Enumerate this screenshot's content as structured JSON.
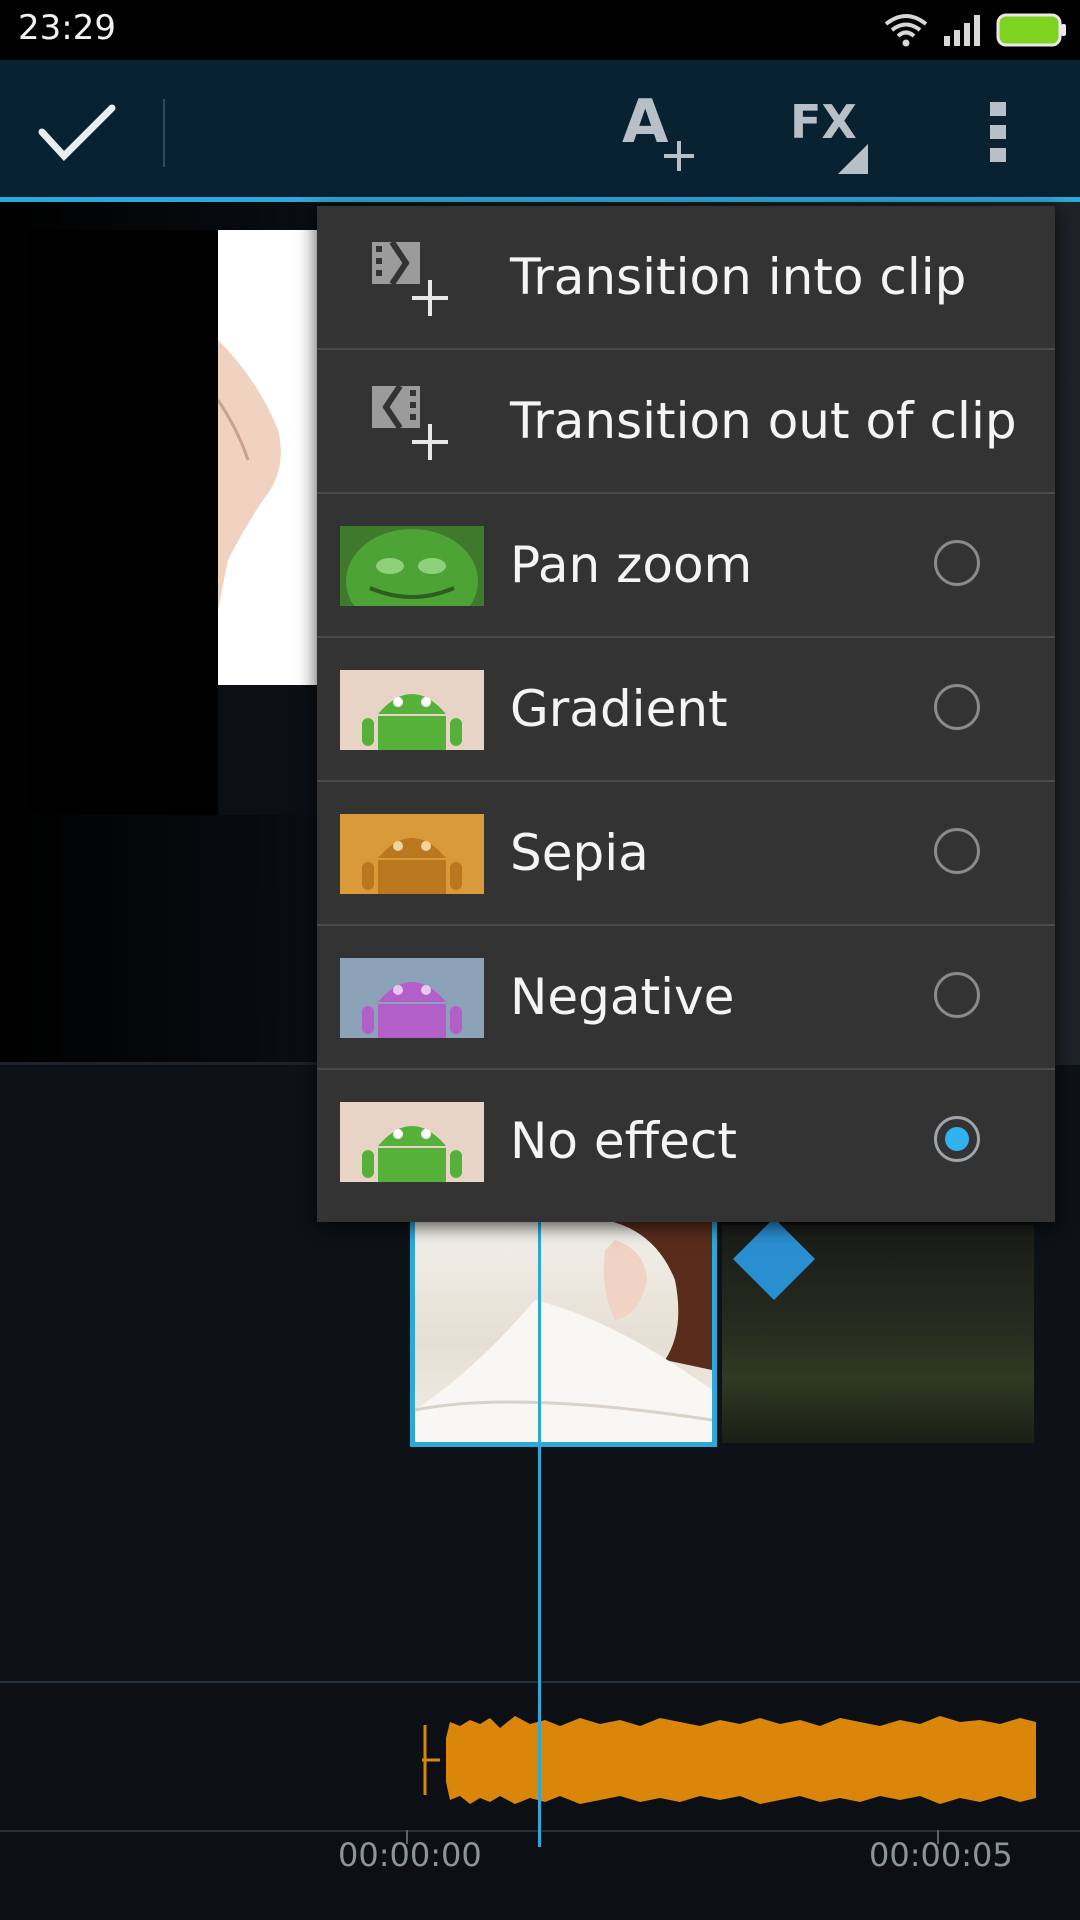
{
  "status_bar": {
    "time": "23:29"
  },
  "action_bar": {
    "done_icon": "checkmark-icon",
    "add_text_icon": "add-text-icon",
    "fx_label": "FX",
    "overflow_icon": "overflow-menu-icon"
  },
  "fx_menu": {
    "transitions": [
      {
        "label": "Transition into clip",
        "icon": "transition-in-icon"
      },
      {
        "label": "Transition out of clip",
        "icon": "transition-out-icon"
      }
    ],
    "effects": [
      {
        "label": "Pan zoom",
        "thumb": "pan-zoom-thumbnail",
        "selected": false
      },
      {
        "label": "Gradient",
        "thumb": "gradient-thumbnail",
        "selected": false
      },
      {
        "label": "Sepia",
        "thumb": "sepia-thumbnail",
        "selected": false
      },
      {
        "label": "Negative",
        "thumb": "negative-thumbnail",
        "selected": false
      },
      {
        "label": "No effect",
        "thumb": "no-effect-thumbnail",
        "selected": true
      }
    ]
  },
  "timeline": {
    "start_time": "00:00:00",
    "end_time": "00:00:05"
  },
  "colors": {
    "accent": "#2ea8d8",
    "audio": "#d9860a",
    "menu_bg": "#333333",
    "action_bar_bg": "#082232"
  }
}
